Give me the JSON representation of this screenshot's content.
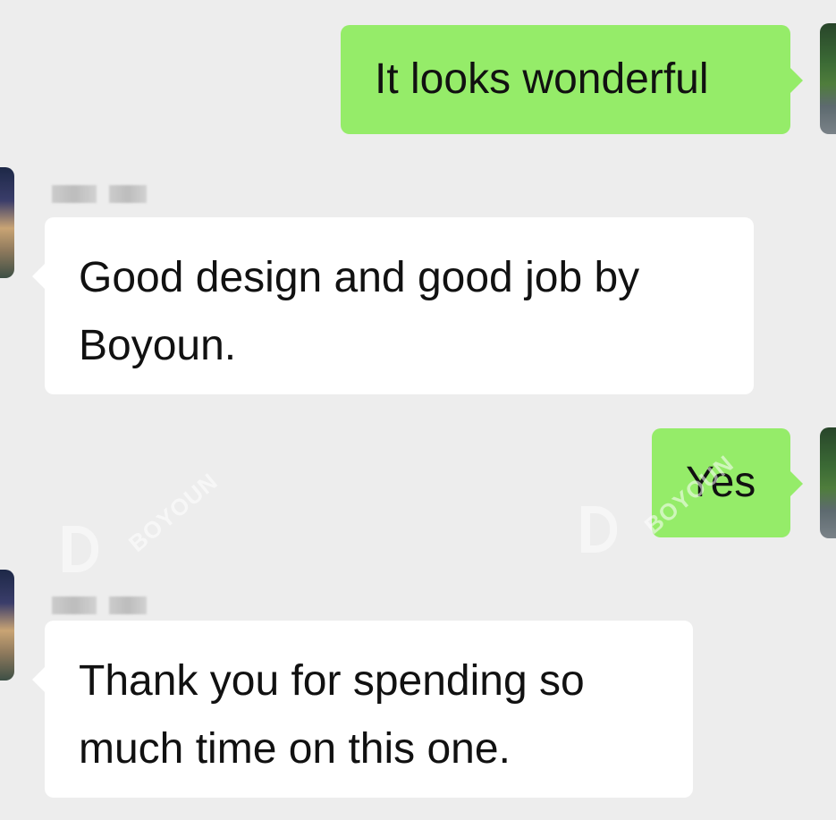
{
  "conversation": {
    "messages": [
      {
        "direction": "outgoing",
        "text": "It looks wonderful"
      },
      {
        "direction": "incoming",
        "text": "Good design and good job by\nBoyoun."
      },
      {
        "direction": "outgoing",
        "text": "Yes"
      },
      {
        "direction": "incoming",
        "text": "Thank you for spending so\nmuch time on this one."
      }
    ]
  },
  "watermark": {
    "text": "BOYOUN"
  },
  "colors": {
    "background": "#ededed",
    "outgoing_bubble": "#95ec69",
    "incoming_bubble": "#ffffff",
    "text": "#111111"
  }
}
